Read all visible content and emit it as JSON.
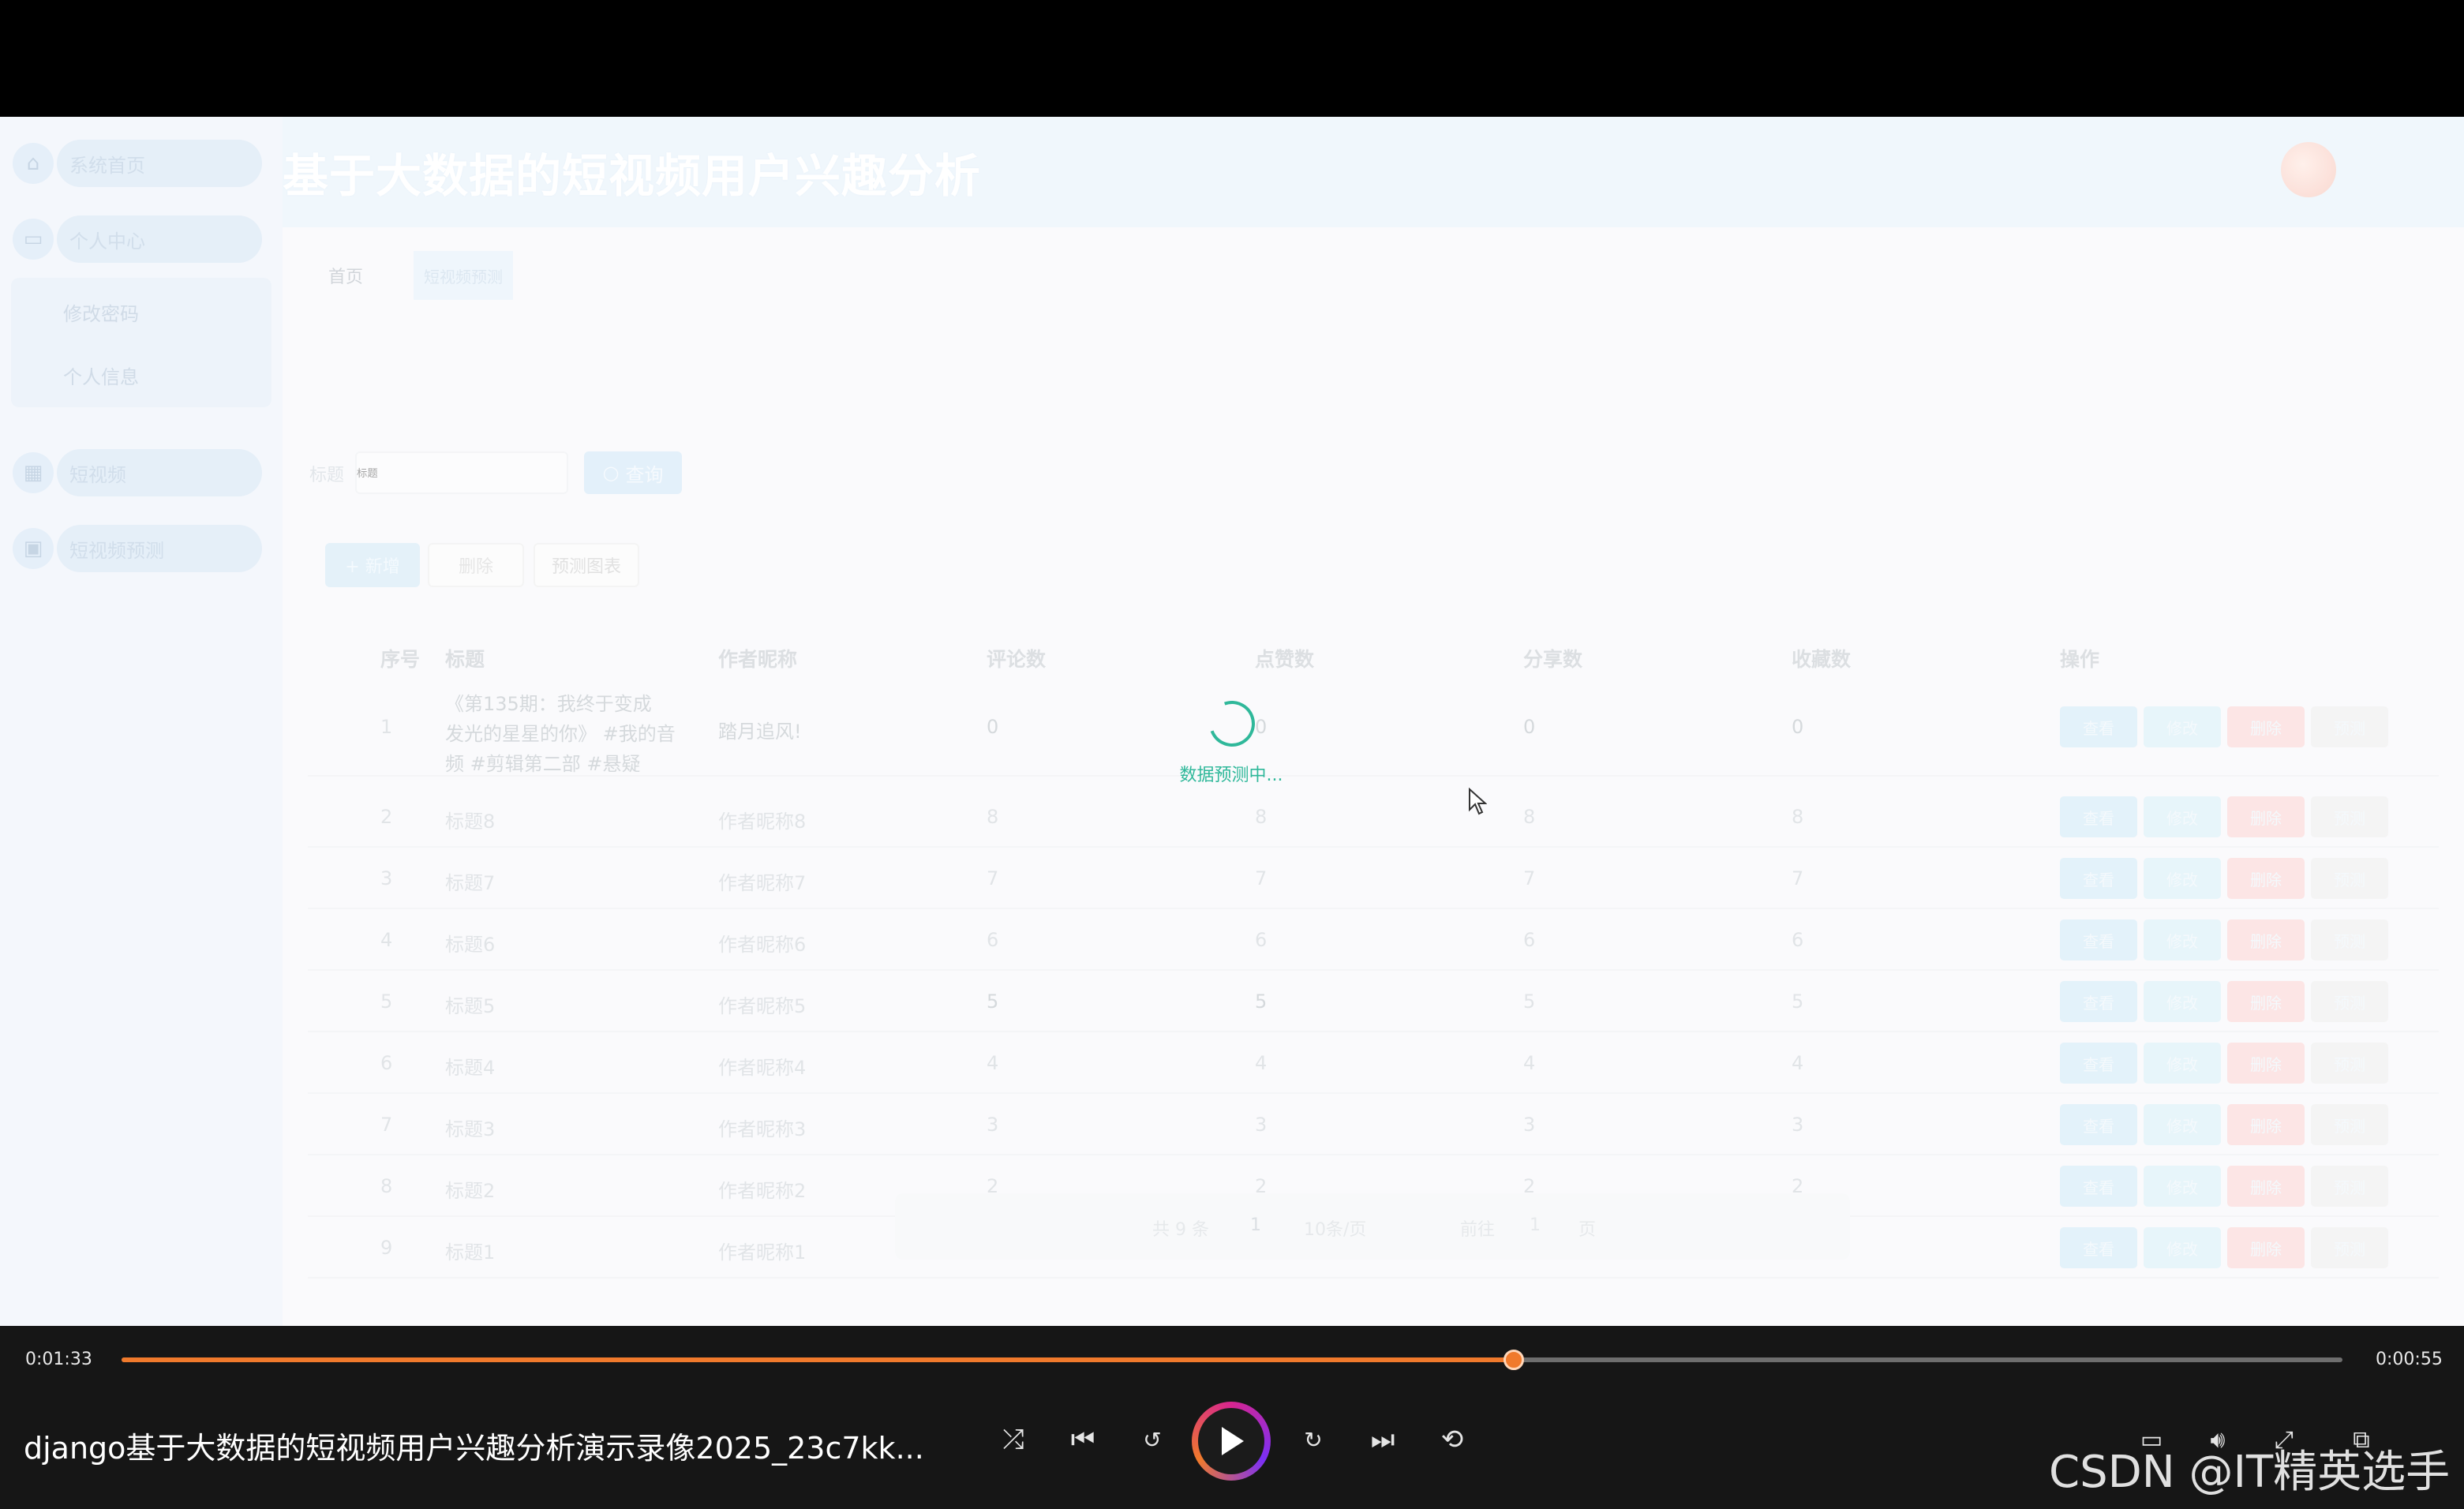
{
  "app": {
    "title": "基于大数据的短视频用户兴趣分析"
  },
  "sidebar": {
    "items": [
      {
        "label": "系统首页",
        "icon": "home-icon"
      },
      {
        "label": "个人中心",
        "icon": "user-card-icon"
      },
      {
        "label": "短视频",
        "icon": "grid-icon"
      },
      {
        "label": "短视频预测",
        "icon": "briefcase-icon"
      }
    ],
    "subitems": [
      "修改密码",
      "个人信息"
    ]
  },
  "breadcrumb": {
    "home": "首页",
    "current": "短视频预测"
  },
  "search": {
    "label": "标题",
    "placeholder": "标题",
    "button": "查询"
  },
  "actions": {
    "add": "+ 新增",
    "delete": "删除",
    "predict_chart": "预测图表"
  },
  "table": {
    "headers": [
      "序号",
      "标题",
      "作者昵称",
      "评论数",
      "点赞数",
      "分享数",
      "收藏数",
      "操作"
    ],
    "op_labels": [
      "查看",
      "修改",
      "删除",
      "预测"
    ],
    "rows": [
      {
        "no": "1",
        "title_l1": "《第135期：我终于变成",
        "title_l2": "发光的星星的你》 #我的音",
        "title_l3": "频 #剪辑第二部 #悬疑",
        "author": "踏月追风!",
        "comments": "0",
        "likes": "0",
        "shares": "0",
        "favorites": "0"
      },
      {
        "no": "2",
        "title_l1": "标题8",
        "author": "作者昵称8",
        "comments": "8",
        "likes": "8",
        "shares": "8",
        "favorites": "8"
      },
      {
        "no": "3",
        "title_l1": "标题7",
        "author": "作者昵称7",
        "comments": "7",
        "likes": "7",
        "shares": "7",
        "favorites": "7"
      },
      {
        "no": "4",
        "title_l1": "标题6",
        "author": "作者昵称6",
        "comments": "6",
        "likes": "6",
        "shares": "6",
        "favorites": "6"
      },
      {
        "no": "5",
        "title_l1": "标题5",
        "author": "作者昵称5",
        "comments": "5",
        "likes": "5",
        "shares": "5",
        "favorites": "5"
      },
      {
        "no": "6",
        "title_l1": "标题4",
        "author": "作者昵称4",
        "comments": "4",
        "likes": "4",
        "shares": "4",
        "favorites": "4"
      },
      {
        "no": "7",
        "title_l1": "标题3",
        "author": "作者昵称3",
        "comments": "3",
        "likes": "3",
        "shares": "3",
        "favorites": "3"
      },
      {
        "no": "8",
        "title_l1": "标题2",
        "author": "作者昵称2",
        "comments": "2",
        "likes": "2",
        "shares": "2",
        "favorites": "2"
      },
      {
        "no": "9",
        "title_l1": "标题1",
        "author": "作者昵称1",
        "comments": "1",
        "likes": "1",
        "shares": "1",
        "favorites": "1"
      }
    ]
  },
  "pagination": {
    "total": "共 9 条",
    "page": "1",
    "page_size": "10条/页",
    "goto_prefix": "前往",
    "goto_value": "1",
    "goto_suffix": "页"
  },
  "loading": {
    "text": "数据预测中..."
  },
  "player": {
    "time_elapsed": "0:01:33",
    "time_remaining": "0:00:55",
    "progress": 0.627,
    "video_title": "django基于大数据的短视频用户兴趣分析演示录像2025_23c7kk...",
    "accent_color": "#f07a2c",
    "controls": [
      "shuffle-icon",
      "previous-icon",
      "rewind-10-icon",
      "play-icon",
      "forward-30-icon",
      "next-icon",
      "repeat-icon",
      "captions-icon",
      "volume-icon",
      "fullscreen-icon",
      "miniplayer-icon"
    ]
  },
  "watermark": "CSDN @IT精英选手"
}
